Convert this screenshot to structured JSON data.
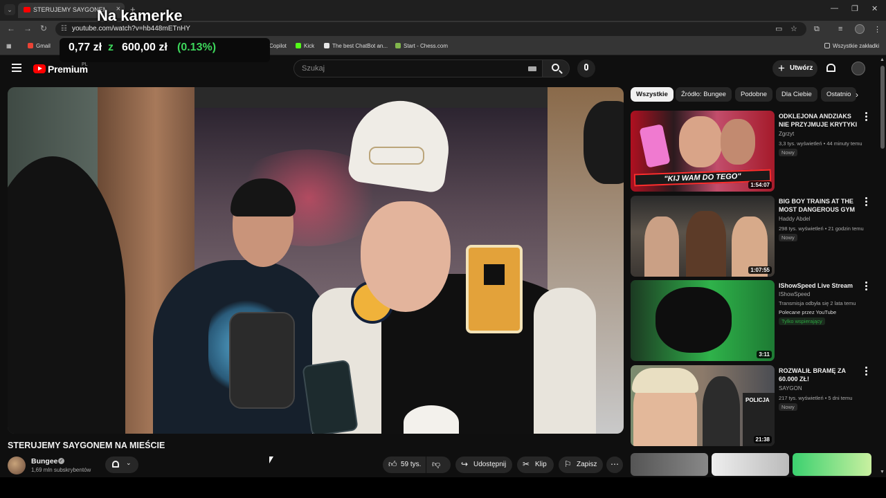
{
  "browser": {
    "tab_title": "STERUJEMY SAYGONEM NA MIEŚCIE",
    "url": "youtube.com/watch?v=hb448mETnHY",
    "bookmarks": [
      "Gmail",
      "geoguser",
      "Copilot",
      "Kick",
      "The best ChatBot an...",
      "Start - Chess.com"
    ],
    "all_bookmarks": "Wszystkie zakładki"
  },
  "overlay": {
    "title": "Na kamerke",
    "amount": "0,77 zł",
    "of": "z",
    "goal": "600,00 zł",
    "percent": "(0.13%)"
  },
  "youtube": {
    "brand": "Premium",
    "region": "PL",
    "search_placeholder": "Szukaj",
    "create_label": "Utwórz"
  },
  "video": {
    "title": "STERUJEMY SAYGONEM NA MIEŚCIE",
    "channel": "Bungee",
    "subscribers": "1,69 mln subskrybentów",
    "likes": "59 tys.",
    "share": "Udostępnij",
    "clip": "Klip",
    "save": "Zapisz"
  },
  "chips": [
    "Wszystkie",
    "Źródło: Bungee",
    "Podobne",
    "Dla Ciebie",
    "Ostatnio"
  ],
  "recommendations": [
    {
      "title": "ODKLEJONA ANDZIAKS NIE PRZYJMUJE KRYTYKI ...",
      "channel": "Zgrzyt",
      "meta": "3,3 tys. wyświetleń • 44 minuty temu",
      "badge": "Nowy",
      "duration": "1:54:07",
      "thumb_text": "\"KIJ WAM DO TEGO\""
    },
    {
      "title": "BIG BOY TRAINS AT THE MOST DANGEROUS GYM I...",
      "channel": "Haddy Abdel",
      "meta": "298 tys. wyświetleń • 21 godzin temu",
      "badge": "Nowy",
      "duration": "1:07:55"
    },
    {
      "title": "IShowSpeed Live Stream",
      "channel": "IShowSpeed",
      "meta": "Transmisja odbyła się 2 lata temu",
      "promo": "Polecane przez YouTube",
      "member": "Tylko wspierający",
      "duration": "3:11"
    },
    {
      "title": "ROZWALIŁ BRAMĘ ZA 60.000 ZŁ!",
      "channel": "SAYGON",
      "meta": "217 tys. wyświetleń • 5 dni temu",
      "badge": "Nowy",
      "duration": "21:38",
      "thumb_text": "POLICJA"
    }
  ],
  "colors": {
    "background": "#0f0f0f",
    "accent_red": "#ff0000",
    "ticker_green": "#3dd65b"
  }
}
